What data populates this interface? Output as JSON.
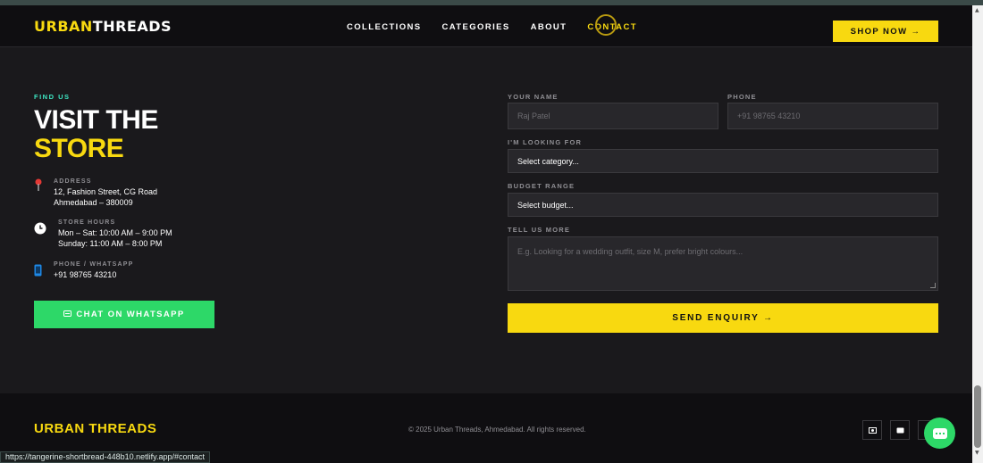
{
  "navbar": {
    "logo_part1": "URBAN",
    "logo_part2": "THREADS",
    "links": [
      "COLLECTIONS",
      "CATEGORIES",
      "ABOUT",
      "CONTACT"
    ],
    "active_link": "CONTACT",
    "shop_button": "SHOP NOW →"
  },
  "contact": {
    "eyebrow": "FIND US",
    "title_line1": "VISIT THE",
    "title_line2": "STORE",
    "address_label": "ADDRESS",
    "address_line1": "12, Fashion Street, CG Road",
    "address_line2": "Ahmedabad – 380009",
    "hours_label": "STORE HOURS",
    "hours_line1": "Mon – Sat: 10:00 AM – 9:00 PM",
    "hours_line2": "Sunday: 11:00 AM – 8:00 PM",
    "phone_label": "PHONE / WHATSAPP",
    "phone_value": "+91 98765 43210",
    "whatsapp_button": "CHAT ON WHATSAPP"
  },
  "form": {
    "name_label": "YOUR NAME",
    "name_placeholder": "Raj Patel",
    "phone_label": "PHONE",
    "phone_placeholder": "+91 98765 43210",
    "looking_label": "I'M LOOKING FOR",
    "looking_value": "Select category...",
    "budget_label": "BUDGET RANGE",
    "budget_value": "Select budget...",
    "more_label": "TELL US MORE",
    "more_placeholder": "E.g. Looking for a wedding outfit, size M, prefer bright colours...",
    "send_button": "SEND ENQUIRY →"
  },
  "footer": {
    "logo": "URBAN THREADS",
    "copyright": "© 2025 Urban Threads, Ahmedabad. All rights reserved."
  },
  "status_url": "https://tangerine-shortbread-448b10.netlify.app/#contact",
  "colors": {
    "accent_yellow": "#f8d910",
    "whatsapp_green": "#2dd868",
    "eyebrow_teal": "#3ee8c4",
    "background": "#1a191c"
  },
  "icons": {
    "address": "map-pin-icon",
    "hours": "clock-icon",
    "phone": "phone-icon",
    "whatsapp": "chat-icon",
    "social": [
      "instagram-icon",
      "message-icon",
      "facebook-icon"
    ]
  }
}
